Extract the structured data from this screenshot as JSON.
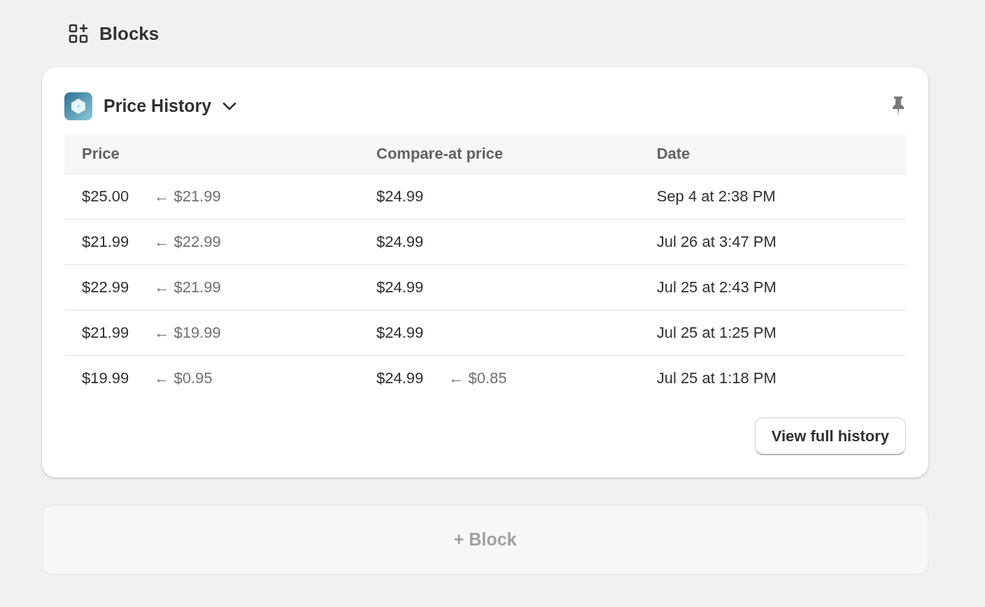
{
  "section": {
    "title": "Blocks"
  },
  "card": {
    "title": "Price History",
    "table": {
      "columns": [
        "Price",
        "Compare-at price",
        "Date"
      ],
      "rows": [
        {
          "price": "$25.00",
          "price_prev": "← $21.99",
          "compare": "$24.99",
          "date": "Sep 4 at 2:38 PM"
        },
        {
          "price": "$21.99",
          "price_prev": "← $22.99",
          "compare": "$24.99",
          "date": "Jul 26 at 3:47 PM"
        },
        {
          "price": "$22.99",
          "price_prev": "← $21.99",
          "compare": "$24.99",
          "date": "Jul 25 at 2:43 PM"
        },
        {
          "price": "$21.99",
          "price_prev": "← $19.99",
          "compare": "$24.99",
          "date": "Jul 25 at 1:25 PM"
        },
        {
          "price": "$19.99",
          "price_prev": "← $0.95",
          "compare": "$24.99",
          "compare_prev": "← $0.85",
          "date": "Jul 25 at 1:18 PM"
        }
      ]
    },
    "button": "View full history"
  },
  "add_block": {
    "label": "+ Block"
  }
}
